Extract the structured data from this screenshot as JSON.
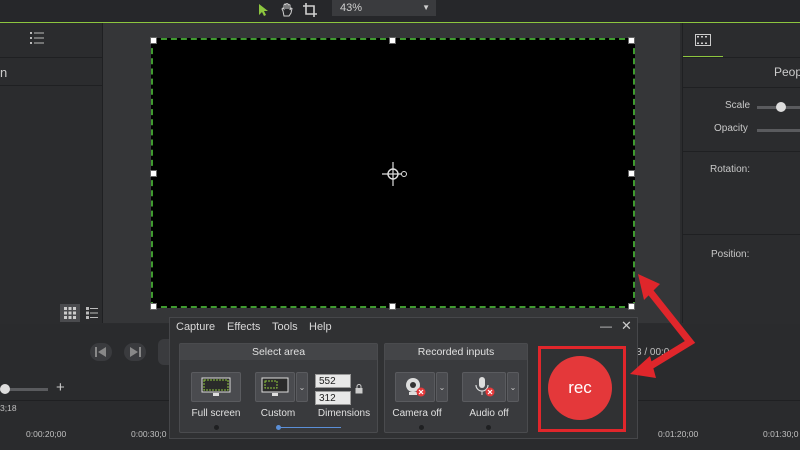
{
  "toolbar": {
    "zoom_value": "43%"
  },
  "left_panel": {
    "header_fragment": "n"
  },
  "right_panel": {
    "header_fragment": "Peop",
    "scale_label": "Scale",
    "opacity_label": "Opacity",
    "rotation_label": "Rotation:",
    "position_label": "Position:"
  },
  "timeline": {
    "time_fragment": "3 / 00:0",
    "start_label": "3;18",
    "ticks": [
      "0:00:20;00",
      "0:00:30;0",
      "0:01:20;00",
      "0:01:30;0"
    ]
  },
  "recorder": {
    "menu": [
      "Capture",
      "Effects",
      "Tools",
      "Help"
    ],
    "select_area": {
      "title": "Select area",
      "full_screen_label": "Full screen",
      "custom_label": "Custom",
      "dimensions_label": "Dimensions",
      "width": "552",
      "height": "312"
    },
    "recorded_inputs": {
      "title": "Recorded inputs",
      "camera_label": "Camera off",
      "audio_label": "Audio off"
    },
    "rec_label": "rec"
  },
  "colors": {
    "accent_green": "#8dc63f",
    "rec_red": "#e4383a",
    "highlight_red": "#e0262b"
  }
}
